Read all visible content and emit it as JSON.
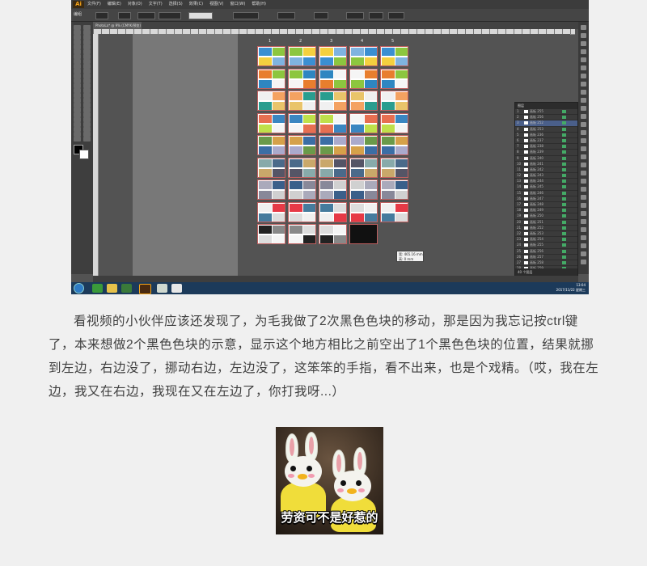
{
  "screenshot": {
    "app_logo": "Ai",
    "menu": [
      "文件(F)",
      "编辑(E)",
      "对象(O)",
      "文字(T)",
      "选择(S)",
      "效果(C)",
      "视图(V)",
      "窗口(W)",
      "帮助(H)"
    ],
    "window_title": "",
    "control_label": "编组",
    "doc_tab": "PhotoLa* @ 9% (CMYK/预览)",
    "artboard_columns": [
      "1",
      "2",
      "3",
      "4",
      "5"
    ],
    "tooltip_line1": "宽: 465.16 mm",
    "tooltip_line2": "高: 0 mm",
    "layers_panel_title": "图层",
    "layer_rows": [
      "画板 255",
      "画板 256",
      "画板 252",
      "画板 253",
      "画板 236",
      "画板 237",
      "画板 238",
      "画板 239",
      "画板 240",
      "画板 241",
      "画板 242",
      "画板 243",
      "画板 244",
      "画板 245",
      "画板 246",
      "画板 247",
      "画板 248",
      "画板 249",
      "画板 250",
      "画板 251",
      "画板 252",
      "画板 253",
      "画板 254",
      "画板 255",
      "画板 256",
      "画板 257",
      "画板 258",
      "画板 259",
      "画板 260",
      "画板 261",
      "画板 262",
      "画板 263",
      "画板 264"
    ],
    "layers_footer": "40 个图层",
    "tray_time": "13:04",
    "tray_date": "2017/11/22 星期三"
  },
  "article": {
    "paragraph": "看视频的小伙伴应该还发现了，为毛我做了2次黑色色块的移动，那是因为我忘记按ctrl键了，本来想做2个黑色色块的示意，显示这个地方相比之前空出了1个黑色色块的位置，结果就挪到左边，右边没了，挪动右边，左边没了，这笨笨的手指，看不出来，也是个戏精。（哎，我在左边，我又在右边，我现在又在左边了，你打我呀...）"
  },
  "meme": {
    "caption": "劳资可不是好惹的"
  },
  "colors": {
    "app_bg": "#535353",
    "page_bg": "#f0f0f0",
    "text": "#404040",
    "artboard_border": "#c06060",
    "layer_selected": "#4a5f8a"
  }
}
